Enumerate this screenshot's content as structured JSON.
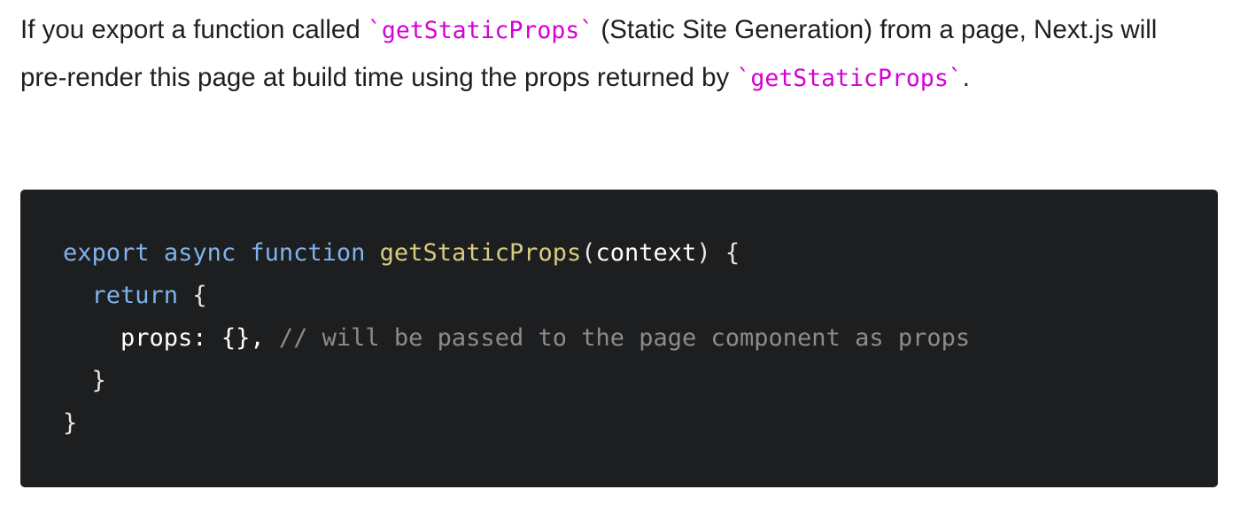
{
  "paragraph": {
    "part1": "If you export a function called ",
    "code1": "`getStaticProps`",
    "part2": " (Static Site Generation) from a page, Next.js will pre-render this page at build time using the props returned by ",
    "code2": "`getStaticProps`",
    "part3": "."
  },
  "code": {
    "line1": {
      "kw_export": "export",
      "kw_async": "async",
      "kw_function": "function",
      "fn_name": "getStaticProps",
      "open_paren": "(",
      "param": "context",
      "close": ") {"
    },
    "line2": {
      "kw_return": "return",
      "brace": " {"
    },
    "line3": {
      "key": "props: {},",
      "comment": "// will be passed to the page component as props"
    },
    "line4": "}",
    "line5": "}"
  },
  "colors": {
    "inline_code": "#d400d4",
    "code_bg": "#1d1e20",
    "keyword": "#7fb3ec",
    "function_name": "#d7cc7f",
    "comment": "#8c8c8c"
  }
}
